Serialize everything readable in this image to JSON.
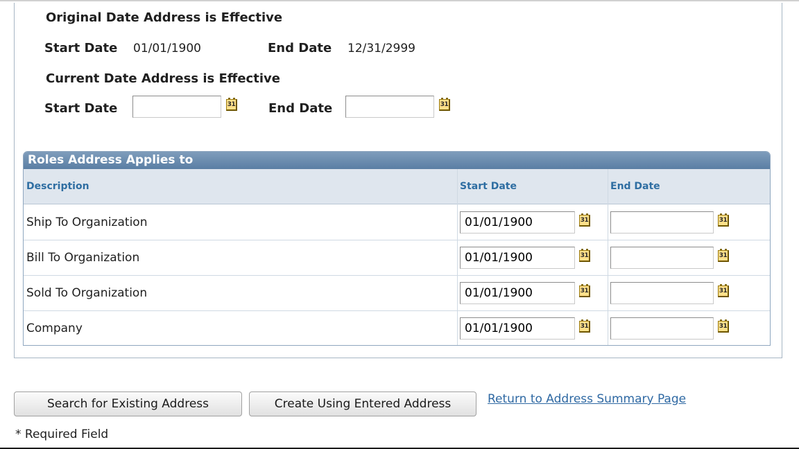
{
  "original_section": {
    "title": "Original Date Address is Effective",
    "start_label": "Start Date",
    "start_value": "01/01/1900",
    "end_label": "End Date",
    "end_value": "12/31/2999"
  },
  "current_section": {
    "title": "Current Date Address is Effective",
    "start_label": "Start Date",
    "start_value": "",
    "end_label": "End Date",
    "end_value": ""
  },
  "calendar_icon_glyph": "31",
  "roles_grid": {
    "title": "Roles Address Applies to",
    "columns": [
      "Description",
      "Start Date",
      "End Date"
    ],
    "rows": [
      {
        "description": "Ship To Organization",
        "start_date": "01/01/1900",
        "end_date": ""
      },
      {
        "description": "Bill To Organization",
        "start_date": "01/01/1900",
        "end_date": ""
      },
      {
        "description": "Sold To Organization",
        "start_date": "01/01/1900",
        "end_date": ""
      },
      {
        "description": "Company",
        "start_date": "01/01/1900",
        "end_date": ""
      }
    ]
  },
  "actions": {
    "search_button": "Search for Existing Address",
    "create_button": "Create Using Entered Address",
    "return_link": "Return to Address Summary Page"
  },
  "required_note": "* Required Field",
  "colors": {
    "grid_header": "#5a7ea4",
    "column_header_text": "#2f6ea2",
    "link": "#2f69a3"
  }
}
